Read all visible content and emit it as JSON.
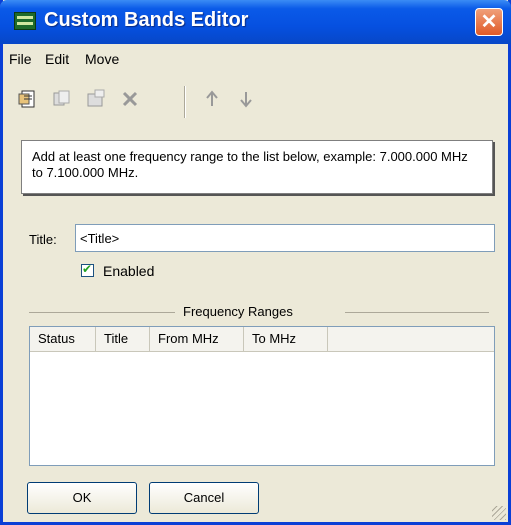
{
  "window": {
    "title": "Custom Bands Editor"
  },
  "menu": {
    "items": [
      "File",
      "Edit",
      "Move"
    ]
  },
  "toolbar": {
    "buttons": [
      {
        "icon": "new-icon"
      },
      {
        "icon": "copy-icon"
      },
      {
        "icon": "properties-icon"
      },
      {
        "icon": "delete-icon"
      },
      {
        "icon": "move-up-icon"
      },
      {
        "icon": "move-down-icon"
      }
    ]
  },
  "info": {
    "text": "Add at least one frequency range to the list below, example: 7.000.000 MHz to 7.100.000 MHz."
  },
  "title_field": {
    "label": "Title:",
    "value": "<Title>"
  },
  "enabled": {
    "label": "Enabled",
    "checked": true
  },
  "ranges": {
    "group_label": "Frequency Ranges",
    "columns": [
      "Status",
      "Title",
      "From MHz",
      "To MHz"
    ],
    "rows": []
  },
  "buttons": {
    "ok": "OK",
    "cancel": "Cancel"
  },
  "colors": {
    "titlebar": "#0650e0",
    "face": "#ece9d8",
    "close": "#e05a28"
  }
}
